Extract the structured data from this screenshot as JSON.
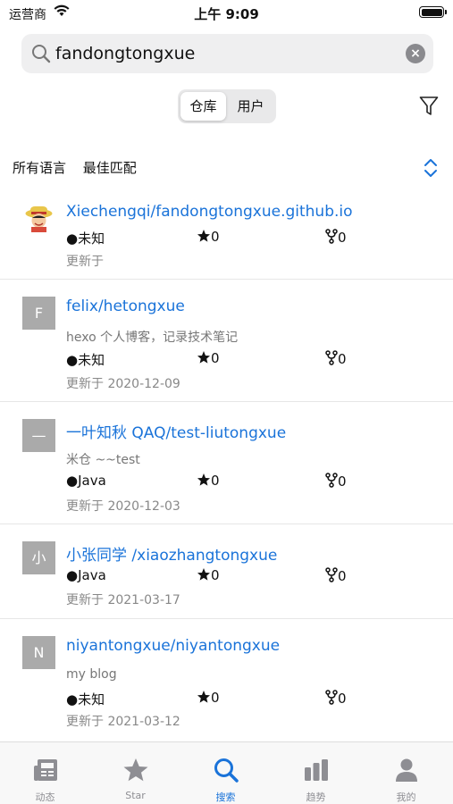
{
  "status": {
    "carrier": "运营商",
    "time": "上午 9:09"
  },
  "search": {
    "query": "fandongtongxue"
  },
  "segments": [
    "仓库",
    "用户"
  ],
  "filters": {
    "language": "所有语言",
    "sort": "最佳匹配"
  },
  "repos": [
    {
      "avatar": "",
      "name": "Xiechengqi/fandongtongxue.github.io",
      "description": "",
      "language": "●未知",
      "stars": "0",
      "forks": "0",
      "updated": "更新于"
    },
    {
      "avatar": "F",
      "name": "felix/hetongxue",
      "description": "hexo 个人博客，记录技术笔记",
      "language": "●未知",
      "stars": "0",
      "forks": "0",
      "updated": "更新于 2020-12-09"
    },
    {
      "avatar": "—",
      "name": "一叶知秋 QAQ/test-liutongxue",
      "description": "米仓 ~~test",
      "language": "●Java",
      "stars": "0",
      "forks": "0",
      "updated": "更新于 2020-12-03"
    },
    {
      "avatar": "小",
      "name": "小张同学 /xiaozhangtongxue",
      "description": "",
      "language": "●Java",
      "stars": "0",
      "forks": "0",
      "updated": "更新于 2021-03-17"
    },
    {
      "avatar": "N",
      "name": "niyantongxue/niyantongxue",
      "description": "my blog",
      "language": "●未知",
      "stars": "0",
      "forks": "0",
      "updated": "更新于 2021-03-12"
    }
  ],
  "tabs": [
    "动态",
    "Star",
    "搜索",
    "趋势",
    "我的"
  ],
  "colors": {
    "accent": "#1a73d9",
    "inactive": "#8e8e93"
  }
}
